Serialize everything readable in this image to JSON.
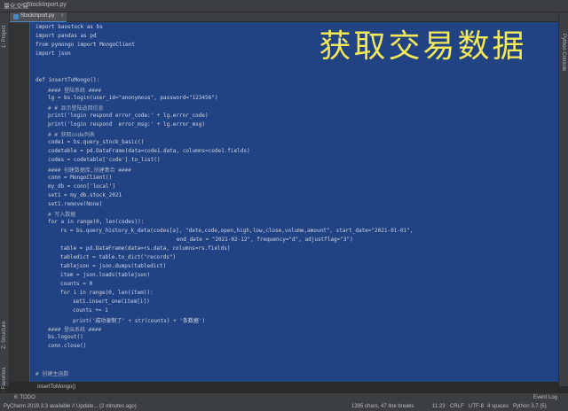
{
  "window": {
    "project": "量化交易",
    "file": "StockInport.py"
  },
  "tab": {
    "label": "StockInport.py"
  },
  "side": {
    "left_top": "1: Project",
    "left_mid": "Z: Structure",
    "left_bot": "2: Favorites",
    "right_top": "Python Console"
  },
  "overlay": {
    "title": "获取交易数据"
  },
  "code": [
    "import baostock as bs",
    "import pandas as pd",
    "from pymongo import MongoClient",
    "import json",
    "",
    "",
    "def insertToMongo():",
    "#### 登陆系统 ####",
    "lg = bs.login(user_id=\"anonymous\", password=\"123456\")",
    "# # 显示登陆返回信息",
    "print('login respond error_code:' + lg.error_code)",
    "print('login respond  error_msg:' + lg.error_msg)",
    "# # 获取code列表",
    "code1 = bs.query_stock_basic()",
    "codetable = pd.DataFrame(data=code1.data, columns=code1.fields)",
    "codes = codetable['code'].to_list()",
    "#### 创建数据库,创建集合 ####",
    "conn = MongoClient()",
    "my_db = conn['local']",
    "set1 = my_db.stock_2021",
    "set1.remove(None)",
    "# 写入数据",
    "for a in range(0, len(codes)):",
    "rs = bs.query_history_k_data(codes[a], \"date,code,open,high,low,close,volume,amount\", start_date=\"2021-01-01\",",
    "end_date = \"2021-02-12\", frequency=\"d\", adjustflag=\"3\")",
    "table = pd.DataFrame(data=rs.data, columns=rs.fields)",
    "tabledict = table.to_dict(\"records\")",
    "tablejson = json.dumps(tabledict)",
    "item = json.loads(tablejson)",
    "counts = 0",
    "for i in range(0, len(item)):",
    "set1.insert_one(item[i])",
    "counts += 1",
    "print('成功录制了' + str(counts) + '条数据')",
    "#### 登出系统 ####",
    "bs.logout()",
    "conn.close()",
    "",
    "",
    "# 创建主函数"
  ],
  "breadcrumb": "insertToMongo()",
  "tool_windows": {
    "todo": "6: TODO",
    "event_log": "Event Log"
  },
  "status": {
    "message": "PyCharm 2019.3.3 available // Update... (2 minutes ago)",
    "chars": "1395 chars, 47 line breaks",
    "position": "11:23",
    "line_sep": "CRLF",
    "encoding": "UTF-8",
    "indent": "4 spaces",
    "interpreter": "Python 3.7 (5)"
  }
}
